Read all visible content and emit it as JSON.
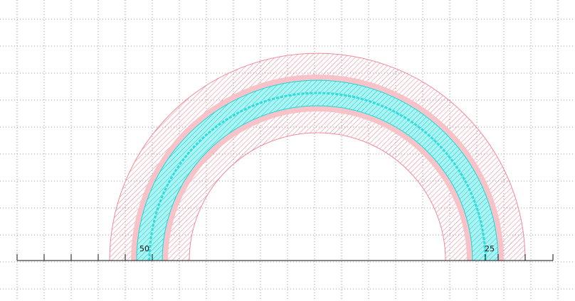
{
  "canvas": {
    "background": "#ffffff",
    "grid": true,
    "grid_color": "#9a9a9a"
  },
  "ruler": {
    "color": "#111111",
    "labels": [
      "50",
      "25"
    ]
  },
  "arc": {
    "shape": "semicircular waveguide bend",
    "layers": [
      {
        "name": "outer-cladding",
        "color": "#f08a9a",
        "fill": "hatched"
      },
      {
        "name": "core",
        "color": "#1ed8d8",
        "fill": "hatched"
      },
      {
        "name": "center-line",
        "color": "#1ed8d8",
        "fill": "dashed"
      }
    ]
  }
}
